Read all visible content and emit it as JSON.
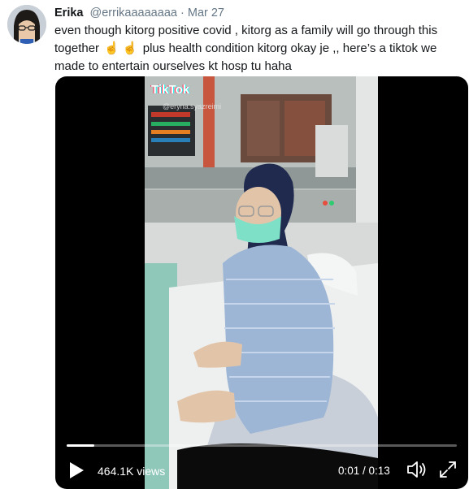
{
  "tweet": {
    "author_name": "Erika",
    "author_handle": "@errikaaaaaaaa",
    "separator": "·",
    "date": "Mar 27",
    "text_part1": "even though kitorg positive covid  , kitorg as a family will go through this together ",
    "emoji1": "☝️",
    "emoji2": "☝️",
    "text_part2": " plus health condition kitorg okay je ,, here’s a tiktok we made to entertain ourselves kt hosp tu haha"
  },
  "video": {
    "tiktok_logo": "TikTok",
    "tiktok_username": "@eryna.syazreimi",
    "views": "464.1K views",
    "time": "0:01 / 0:13",
    "progress_fraction": 0.07,
    "icons": {
      "play": "play-icon",
      "volume": "volume-icon",
      "fullscreen": "fullscreen-icon"
    }
  },
  "colors": {
    "name": "#14171a",
    "muted": "#657786",
    "video_bg": "#000000"
  }
}
